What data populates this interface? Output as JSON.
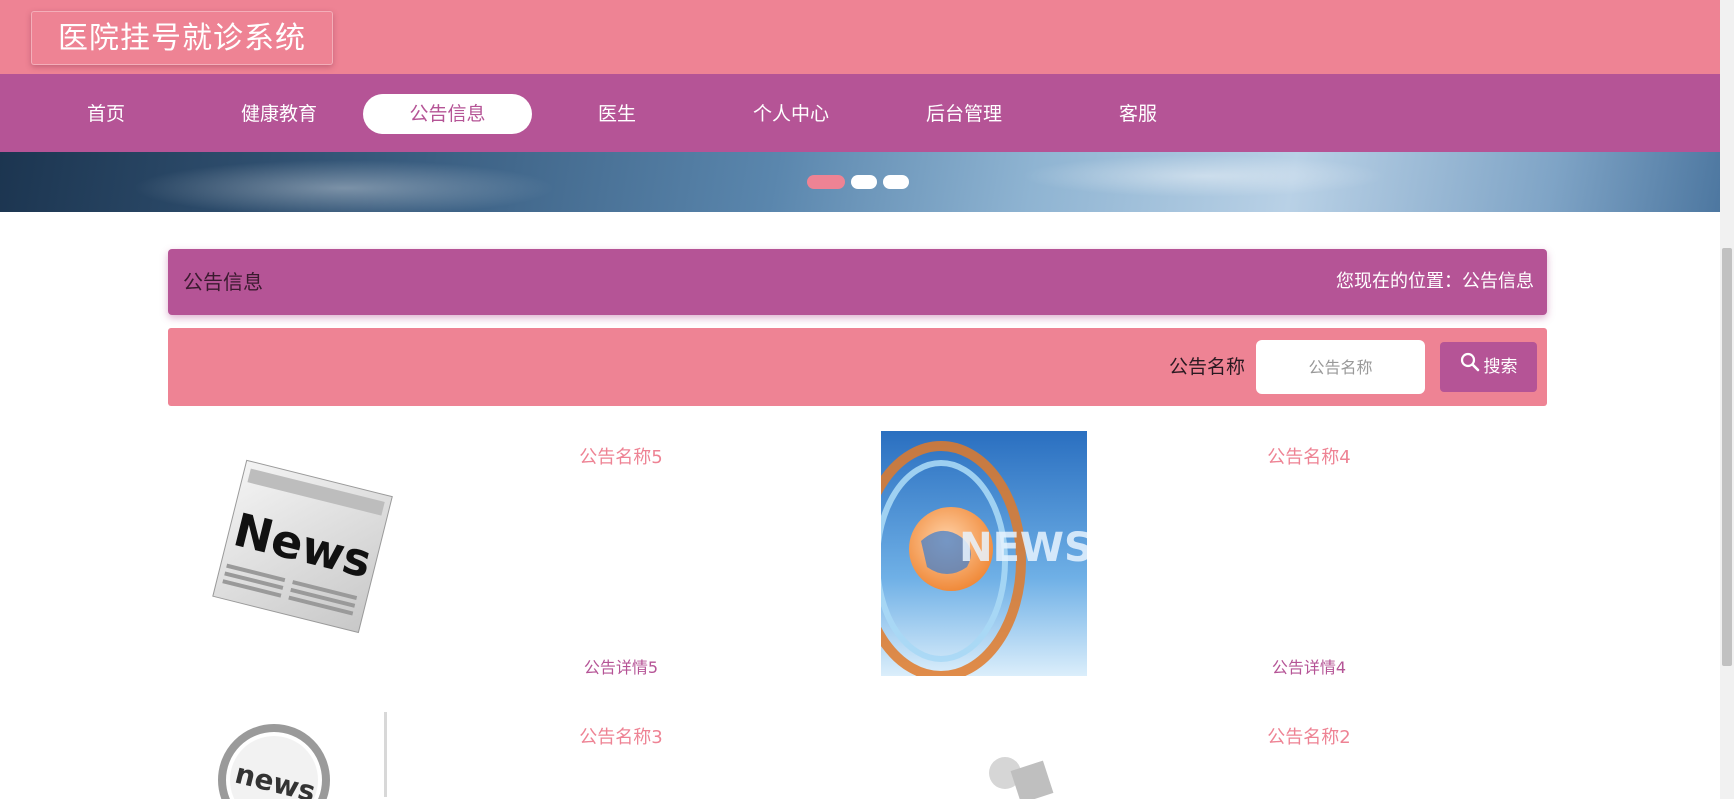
{
  "site": {
    "title": "医院挂号就诊系统"
  },
  "nav": {
    "items": [
      {
        "label": "首页"
      },
      {
        "label": "健康教育"
      },
      {
        "label": "公告信息"
      },
      {
        "label": "医生"
      },
      {
        "label": "个人中心"
      },
      {
        "label": "后台管理"
      },
      {
        "label": "客服"
      }
    ],
    "active_index": 2
  },
  "banner": {
    "slide_count": 3,
    "active_slide": 1
  },
  "section": {
    "title": "公告信息",
    "breadcrumb": "您现在的位置：公告信息"
  },
  "search": {
    "label": "公告名称",
    "placeholder": "公告名称",
    "button_label": "搜索"
  },
  "notices": [
    {
      "title": "公告名称5",
      "detail": "公告详情5",
      "image_text": "News",
      "image_icon": "newspaper-image"
    },
    {
      "title": "公告名称4",
      "detail": "公告详情4",
      "image_text": "NEWS",
      "image_icon": "globe-news-image"
    },
    {
      "title": "公告名称3",
      "detail": "",
      "image_text": "news",
      "image_icon": "magnifier-news-image"
    },
    {
      "title": "公告名称2",
      "detail": "",
      "image_text": "",
      "image_icon": "figure-reading-image"
    }
  ],
  "colors": {
    "header_pink": "#ee8394",
    "nav_purple": "#b55496"
  }
}
